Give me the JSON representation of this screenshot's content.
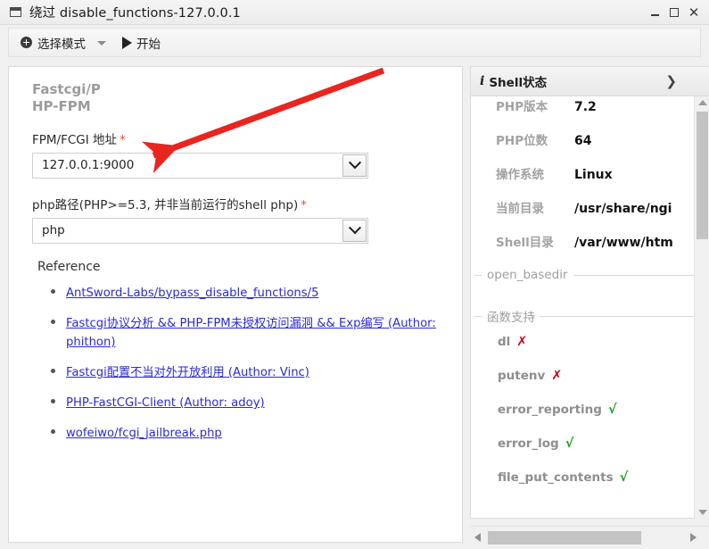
{
  "window": {
    "title": "绕过 disable_functions-127.0.0.1",
    "icon": "window-icon",
    "controls": [
      {
        "name": "minimize-button",
        "label": "—"
      },
      {
        "name": "maximize-button",
        "label": "□"
      },
      {
        "name": "close-button",
        "label": "✕"
      }
    ]
  },
  "toolbar": {
    "mode_label": "选择模式",
    "start_label": "开始"
  },
  "left_panel": {
    "section_title": "Fastcgi/PHP-FPM",
    "fields": [
      {
        "label": "FPM/FCGI 地址",
        "required_mark": "*",
        "value": "127.0.0.1:9000"
      },
      {
        "label": "php路径(PHP>=5.3, 并非当前运行的shell php)",
        "required_mark": "*",
        "value": "php"
      }
    ],
    "reference_heading": "Reference",
    "references": [
      "AntSword-Labs/bypass_disable_functions/5",
      "Fastcgi协议分析 && PHP-FPM未授权访问漏洞 && Exp编写 (Author: phithon)",
      "Fastcgi配置不当对外开放利用 (Author: Vinc)",
      "PHP-FastCGI-Client (Author: adoy)",
      "wofeiwo/fcgi_jailbreak.php"
    ]
  },
  "right_panel": {
    "header": {
      "info_mark": "i",
      "title": "Shell状态",
      "chevron": "❯"
    },
    "status_rows": [
      {
        "key": "PHP版本",
        "value": "7.2"
      },
      {
        "key": "PHP位数",
        "value": "64"
      },
      {
        "key": "操作系统",
        "value": "Linux"
      },
      {
        "key": "当前目录",
        "value": "/usr/share/ngi"
      },
      {
        "key": "Shell目录",
        "value": "/var/www/htm"
      }
    ],
    "open_basedir": {
      "legend": "open_basedir",
      "items": []
    },
    "function_support": {
      "legend": "函数支持",
      "items": [
        {
          "name": "dl",
          "mark": "✗",
          "supported": false
        },
        {
          "name": "putenv",
          "mark": "✗",
          "supported": false
        },
        {
          "name": "error_reporting",
          "mark": "√",
          "supported": true
        },
        {
          "name": "error_log",
          "mark": "√",
          "supported": true
        },
        {
          "name": "file_put_contents",
          "mark": "√",
          "supported": true
        }
      ]
    }
  },
  "annotation": {
    "color": "#e8251f"
  },
  "colors": {
    "link": "#2b2bd4",
    "required": "#e0503a",
    "supported": "#1aa51a",
    "unsupported": "#d0021b",
    "muted": "#9b9b9b"
  }
}
